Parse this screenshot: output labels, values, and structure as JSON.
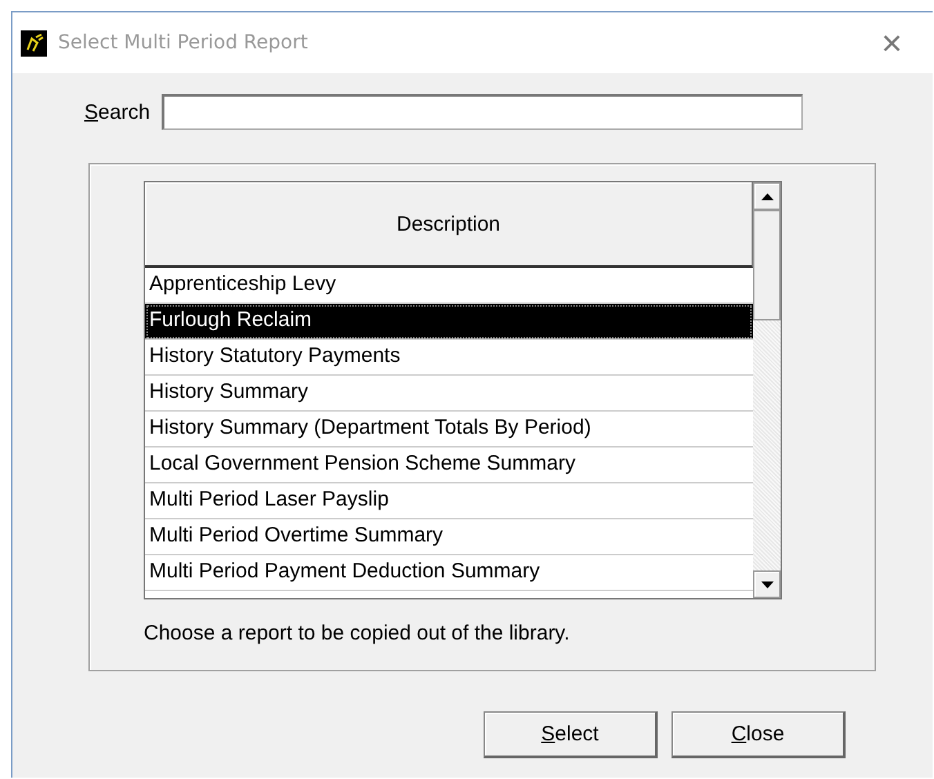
{
  "window": {
    "title": "Select Multi Period Report",
    "close": "×"
  },
  "search": {
    "label": "Search"
  },
  "table": {
    "columns": [
      "Description"
    ],
    "rows": [
      {
        "label": "Apprenticeship Levy",
        "selected": false
      },
      {
        "label": "Furlough Reclaim",
        "selected": true
      },
      {
        "label": "History Statutory Payments",
        "selected": false
      },
      {
        "label": "History Summary",
        "selected": false
      },
      {
        "label": "History Summary (Department Totals By Period)",
        "selected": false
      },
      {
        "label": "Local Government Pension Scheme Summary",
        "selected": false
      },
      {
        "label": "Multi Period Laser Payslip",
        "selected": false
      },
      {
        "label": "Multi Period Overtime Summary",
        "selected": false
      },
      {
        "label": "Multi Period Payment Deduction Summary",
        "selected": false
      }
    ]
  },
  "hint": "Choose a report to be copied out of the library.",
  "buttons": [
    "Select",
    "Close"
  ]
}
